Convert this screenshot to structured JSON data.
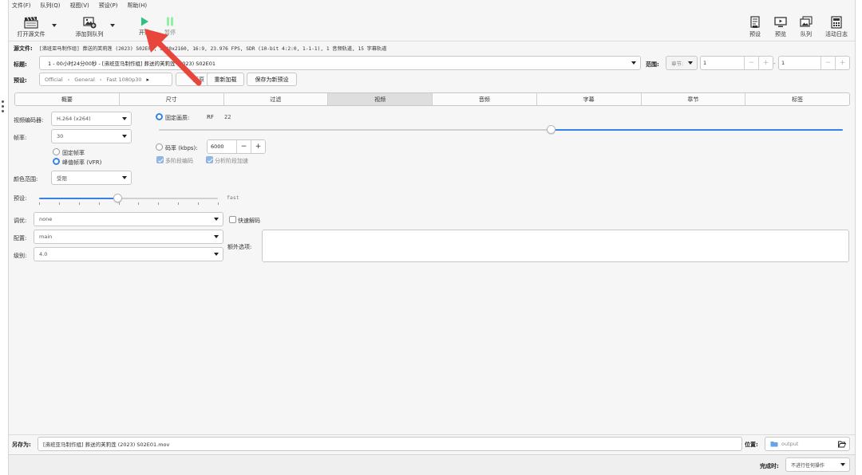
{
  "menu": [
    "文件(F)",
    "队列(Q)",
    "视图(V)",
    "预设(P)",
    "帮助(H)"
  ],
  "toolbar": {
    "open_source": "打开源文件",
    "add_to_queue": "添加到队列",
    "start": "开始",
    "pause": "暂停",
    "presets": "预设",
    "preview": "预览",
    "queue": "队列",
    "activity_log": "活动日志"
  },
  "source": {
    "label": "源文件:",
    "value": "[沸班亚马制作组] 葬送的芙莉莲 (2023) S02E01, 3840x2160, 16:9, 23.976 FPS, SDR (10-bit 4:2:0, 1-1-1), 1 音频轨道, 15 字幕轨道"
  },
  "title": {
    "label": "标题:",
    "value": "1 - 00小时24分00秒 - [沸班亚马制作组] 葬送的芙莉莲 (2023) S02E01"
  },
  "range": {
    "label": "范围:",
    "mode": "章节:",
    "start": "1",
    "end": "1",
    "dash": "-"
  },
  "preset": {
    "label": "预设:",
    "path": [
      "Official",
      "General",
      "Fast 1080p30"
    ],
    "reload": "重新加载",
    "save_new": "保存为新预设",
    "hidden_btn": "还原"
  },
  "tabs": [
    "概要",
    "尺寸",
    "过滤",
    "视频",
    "音频",
    "字幕",
    "章节",
    "标签"
  ],
  "active_tab": 3,
  "video": {
    "encoder_label": "视频编码器:",
    "encoder_value": "H.264 (x264)",
    "framerate_label": "帧率:",
    "framerate_value": "30",
    "cfr_label": "固定帧率",
    "pfr_label": "峰值帧率 (VFR)",
    "color_range_label": "颜色范围:",
    "color_range_value": "受限",
    "quality_label": "固定画质:",
    "rf_label": "RF",
    "rf_value": "22",
    "rf_fraction": 0.574,
    "bitrate_label": "码率 (kbps):",
    "bitrate_value": "6000",
    "multipass_label": "多阶段编码",
    "turbo_label": "分析阶段加速",
    "preset_label": "预设:",
    "preset_value": "fast",
    "preset_fraction": 0.44,
    "tune_label": "调优:",
    "tune_value": "none",
    "fastdecode_label": "快速解码",
    "profile_label": "配置:",
    "profile_value": "main",
    "level_label": "级别:",
    "level_value": "4.0",
    "extra_label": "额外选项:",
    "extra_value": ""
  },
  "save": {
    "label": "另存为:",
    "filename": "[沸班亚马制作组] 葬送的芙莉莲 (2023) S02E01.mov",
    "location_label": "位置:",
    "location_value": "output"
  },
  "footer": {
    "when_done_label": "完成时:",
    "when_done_value": "不进行任何操作"
  },
  "colors": {
    "accent": "#3584e4",
    "start_green": "#2ec27e",
    "pause_green": "#8ff0a4",
    "arrow_red": "#e8453c"
  }
}
